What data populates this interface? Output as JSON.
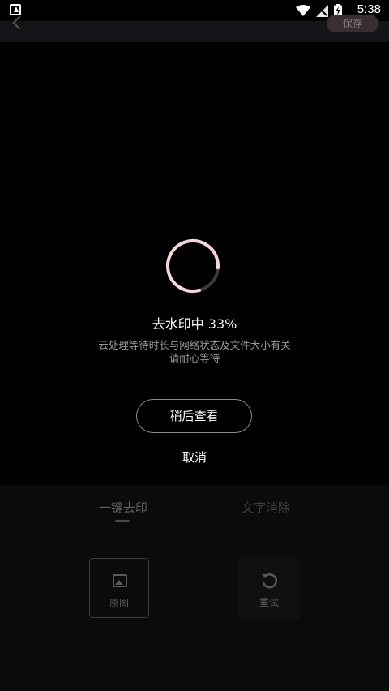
{
  "status_bar": {
    "time": "5:38"
  },
  "header": {
    "save_label": "保存"
  },
  "progress": {
    "title": "去水印中 33%",
    "percent": 33,
    "note_line1": "云处理等待时长与网络状态及文件大小有关",
    "note_line2": "请耐心等待",
    "later_label": "稍后查看",
    "cancel_label": "取消"
  },
  "tabs": [
    {
      "label": "一键去印"
    },
    {
      "label": "文字消除"
    }
  ],
  "tools": [
    {
      "label": "原图",
      "icon": "image-icon"
    },
    {
      "label": "重试",
      "icon": "refresh-icon"
    }
  ],
  "colors": {
    "spinner_active": "#f6d6d8",
    "spinner_track": "#3a3a3c"
  }
}
